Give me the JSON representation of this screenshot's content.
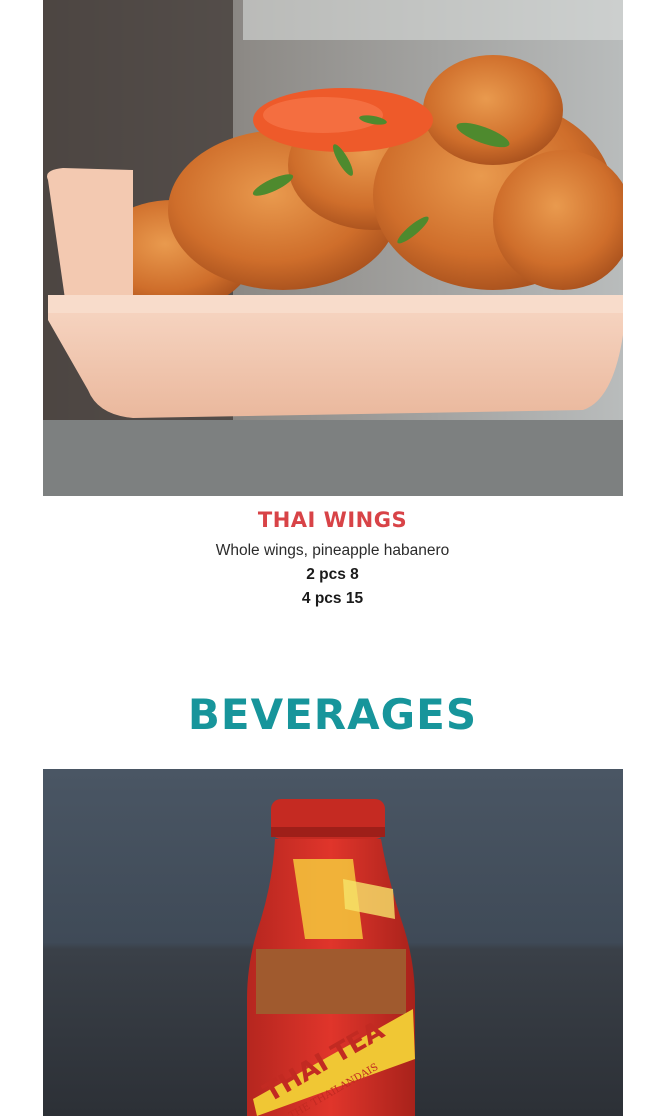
{
  "menu_item": {
    "title": "THAI WINGS",
    "description": "Whole wings, pineapple habanero",
    "prices": [
      "2 pcs 8",
      "4 pcs 15"
    ]
  },
  "section": {
    "heading": "BEVERAGES"
  },
  "beverage_photo": {
    "bottle_label": "THAI TEA",
    "bottle_sublabel": "THE THAILANDAIS"
  },
  "colors": {
    "item_title": "#d84347",
    "section_heading": "#17959b",
    "price_text": "#1a1a1a",
    "description_text": "#2b2b2b"
  }
}
